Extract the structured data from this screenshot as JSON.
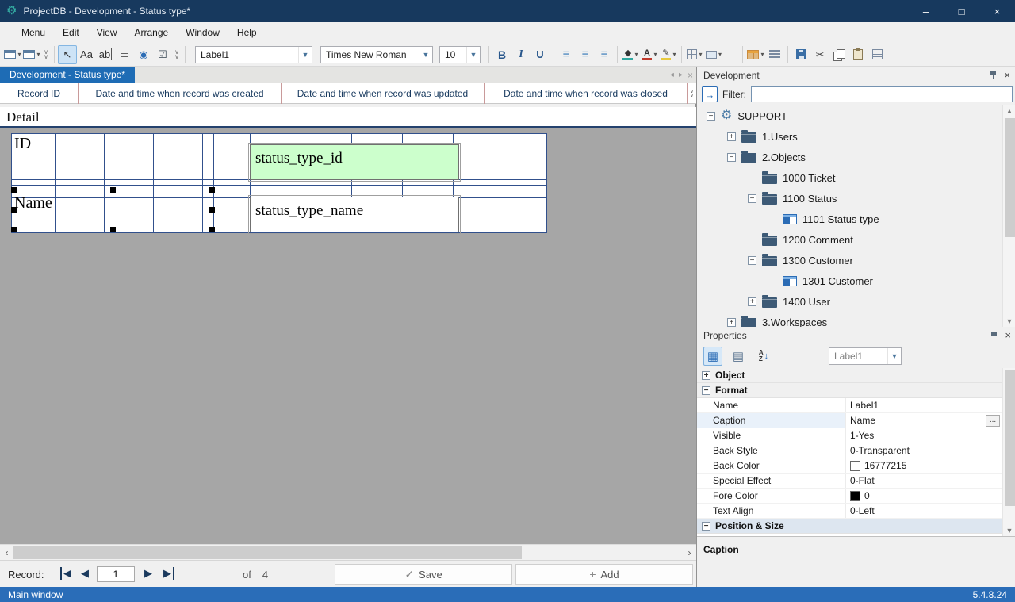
{
  "window": {
    "title": "ProjectDB - Development - Status type*",
    "minimize": "–",
    "maximize": "□",
    "close": "×"
  },
  "menubar": {
    "items": [
      "Menu",
      "Edit",
      "View",
      "Arrange",
      "Window",
      "Help"
    ]
  },
  "toolbar": {
    "style_combo": "Label1",
    "font_combo": "Times New Roman",
    "size_combo": "10",
    "bold": "B",
    "italic": "I",
    "underline": "U",
    "font_icon": "Aa",
    "textbox_icon": "ab"
  },
  "tabbar": {
    "active_tab": "Development - Status type*"
  },
  "record_grid": {
    "columns": [
      "Record ID",
      "Date and time when record was created",
      "Date and time when record was updated",
      "Date and time when record was closed"
    ]
  },
  "designer": {
    "section": "Detail",
    "id_label": "ID",
    "id_field": "status_type_id",
    "name_label": "Name",
    "name_field": "status_type_name",
    "field_green": "#ccffcc",
    "field_white": "#ffffff"
  },
  "dev_panel": {
    "title": "Development",
    "filter_label": "Filter:",
    "filter_value": "",
    "tree": [
      {
        "label": "SUPPORT",
        "expander": "−",
        "icon": "support-icon"
      },
      {
        "label": "1.Users",
        "expander": "+",
        "icon": "folder-icon"
      },
      {
        "label": "2.Objects",
        "expander": "−",
        "icon": "folder-icon"
      },
      {
        "label": "1000 Ticket",
        "expander": "",
        "icon": "folder-icon"
      },
      {
        "label": "1100 Status",
        "expander": "−",
        "icon": "folder-icon"
      },
      {
        "label": "1101 Status type",
        "expander": "",
        "icon": "form-icon"
      },
      {
        "label": "1200 Comment",
        "expander": "",
        "icon": "folder-icon"
      },
      {
        "label": "1300 Customer",
        "expander": "−",
        "icon": "folder-icon"
      },
      {
        "label": "1301 Customer",
        "expander": "",
        "icon": "form-icon"
      },
      {
        "label": "1400 User",
        "expander": "+",
        "icon": "folder-icon"
      },
      {
        "label": "3.Workspaces",
        "expander": "+",
        "icon": "folder-icon"
      }
    ]
  },
  "properties": {
    "title": "Properties",
    "object_combo": "Label1",
    "expanders": {
      "object": "+",
      "format": "−",
      "possize": "−"
    },
    "groups": {
      "object": "Object",
      "format": "Format",
      "possize": "Position & Size"
    },
    "rows": [
      {
        "name": "Name",
        "value": "Label1"
      },
      {
        "name": "Caption",
        "value": "Name",
        "ellipsis": "..."
      },
      {
        "name": "Visible",
        "value": "1-Yes"
      },
      {
        "name": "Back Style",
        "value": "0-Transparent"
      },
      {
        "name": "Back Color",
        "value": "16777215",
        "swatch": "#ffffff"
      },
      {
        "name": "Special Effect",
        "value": "0-Flat"
      },
      {
        "name": "Fore Color",
        "value": "0",
        "swatch": "#000000"
      },
      {
        "name": "Text Align",
        "value": "0-Left"
      }
    ],
    "description": "Caption"
  },
  "record_bar": {
    "label": "Record:",
    "current": "1",
    "of": "of",
    "total": "4",
    "save": "Save",
    "add": "Add"
  },
  "statusbar": {
    "left": "Main window",
    "right": "5.4.8.24"
  },
  "colors": {
    "titlebar": "#17395e",
    "tab_active": "#1e6cb5",
    "statusbar": "#2a6db8",
    "canvas": "#a6a6a6",
    "grid_line": "#31508c",
    "folder": "#3d5a76",
    "accent": "#2b6cb5"
  }
}
